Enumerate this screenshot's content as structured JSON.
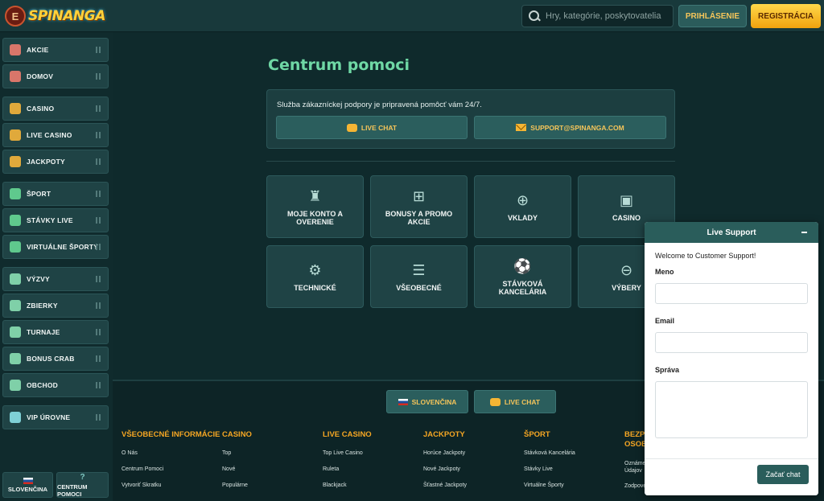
{
  "header": {
    "logo_text": "SPINANGA",
    "menu_icon_glyph": "E",
    "search_placeholder": "Hry, kategórie, poskytovatelia",
    "login_label": "PRIHLÁSENIE",
    "register_label": "REGISTRÁCIA"
  },
  "sidebar": {
    "items": [
      {
        "label": "AKCIE",
        "icon": "gift-icon",
        "color": "#d9766a"
      },
      {
        "label": "DOMOV",
        "icon": "home-icon",
        "color": "#d9766a"
      },
      {
        "label": "CASINO",
        "icon": "slot-machine-icon",
        "color": "#e0a93b"
      },
      {
        "label": "LIVE CASINO",
        "icon": "dealer-icon",
        "color": "#e0a93b"
      },
      {
        "label": "JACKPOTY",
        "icon": "coins-icon",
        "color": "#e0a93b"
      },
      {
        "label": "ŠPORT",
        "icon": "soccer-ball-icon",
        "color": "#5fc98d"
      },
      {
        "label": "STÁVKY LIVE",
        "icon": "live-screen-icon",
        "color": "#5fc98d"
      },
      {
        "label": "VIRTUÁLNE ŠPORTY",
        "icon": "virtual-sport-icon",
        "color": "#5fc98d"
      },
      {
        "label": "VÝZVY",
        "icon": "medal-icon",
        "color": "#7fd0a8"
      },
      {
        "label": "ZBIERKY",
        "icon": "cards-icon",
        "color": "#7fd0a8"
      },
      {
        "label": "TURNAJE",
        "icon": "trophy-icon",
        "color": "#7fd0a8"
      },
      {
        "label": "BONUS CRAB",
        "icon": "crab-icon",
        "color": "#7fd0a8"
      },
      {
        "label": "OBCHOD",
        "icon": "shop-icon",
        "color": "#7fd0a8"
      },
      {
        "label": "VIP ÚROVNE",
        "icon": "diamond-icon",
        "color": "#7fd0d6"
      }
    ],
    "language_label": "SLOVENČINA",
    "help_label": "CENTRUM POMOCI"
  },
  "main": {
    "title": "Centrum pomoci",
    "support_text": "Služba zákazníckej podpory je pripravená pomôcť vám 24/7.",
    "live_chat_label": "LIVE CHAT",
    "email_label": "SUPPORT@SPINANGA.COM",
    "categories": [
      {
        "label": "MOJE KONTO A OVERENIE",
        "icon": "account-icon",
        "glyph": "♜"
      },
      {
        "label": "BONUSY A PROMO AKCIE",
        "icon": "gift-icon",
        "glyph": "⊞"
      },
      {
        "label": "VKLADY",
        "icon": "deposit-coins-icon",
        "glyph": "⊕"
      },
      {
        "label": "CASINO",
        "icon": "slot-machine-icon",
        "glyph": "▣"
      },
      {
        "label": "TECHNICKÉ",
        "icon": "gear-icon",
        "glyph": "⚙"
      },
      {
        "label": "VŠEOBECNÉ",
        "icon": "list-icon",
        "glyph": "☰"
      },
      {
        "label": "STÁVKOVÁ KANCELÁRIA",
        "icon": "soccer-ball-icon",
        "glyph": "⚽"
      },
      {
        "label": "VÝBERY",
        "icon": "withdraw-coins-icon",
        "glyph": "⊖"
      }
    ]
  },
  "footer": {
    "language_label": "SLOVENČINA",
    "live_chat_label": "LIVE CHAT",
    "columns": [
      {
        "title": "VŠEOBECNÉ INFORMÁCIE",
        "links": [
          "O Nás",
          "Centrum Pomoci",
          "Vytvoriť Skratku"
        ]
      },
      {
        "title": "CASINO",
        "links": [
          "Top",
          "Nové",
          "Populárne"
        ]
      },
      {
        "title": "LIVE CASINO",
        "links": [
          "Top Live Casino",
          "Ruleta",
          "Blackjack"
        ]
      },
      {
        "title": "JACKPOTY",
        "links": [
          "Horúce Jackpoty",
          "Nové Jackpoty",
          "Šťastné Jackpoty"
        ]
      },
      {
        "title": "ŠPORT",
        "links": [
          "Stávková Kancelária",
          "Stávky Live",
          "Virtuálne Športy"
        ]
      },
      {
        "title": "BEZPE OSOB",
        "links": [
          "Oznáme Údajov",
          "Zodpove"
        ]
      }
    ]
  },
  "widget": {
    "title": "Live Support",
    "welcome": "Welcome to Customer Support!",
    "name_label": "Meno",
    "email_label": "Email",
    "message_label": "Správa",
    "start_button": "Začať chat"
  }
}
